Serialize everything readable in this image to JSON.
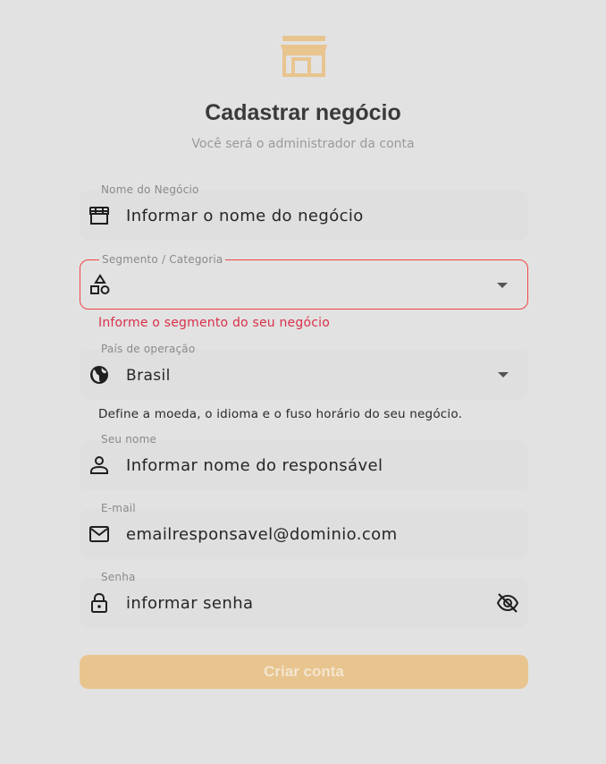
{
  "header": {
    "title": "Cadastrar negócio",
    "subtitle": "Você será o administrador da conta",
    "logo_icon": "storefront-icon",
    "accent_color": "#e8c48f"
  },
  "form": {
    "business_name": {
      "label": "Nome do Negócio",
      "placeholder": "Informar o nome do negócio",
      "icon": "storefront-icon"
    },
    "segment": {
      "label": "Segmento / Categoria",
      "value": "",
      "icon": "category-shapes-icon",
      "error": "Informe o segmento do seu negócio",
      "error_color": "#ef4444"
    },
    "country": {
      "label": "País de operação",
      "value": "Brasil",
      "icon": "globe-icon",
      "helper": "Define a moeda, o idioma e o fuso horário do seu negócio."
    },
    "name": {
      "label": "Seu nome",
      "placeholder": "Informar nome do responsável",
      "icon": "person-icon"
    },
    "email": {
      "label": "E-mail",
      "placeholder": "emailresponsavel@dominio.com",
      "icon": "mail-icon"
    },
    "password": {
      "label": "Senha",
      "placeholder": "informar senha",
      "icon": "lock-icon",
      "toggle_icon": "eye-off-icon"
    }
  },
  "actions": {
    "submit_label": "Criar conta"
  }
}
